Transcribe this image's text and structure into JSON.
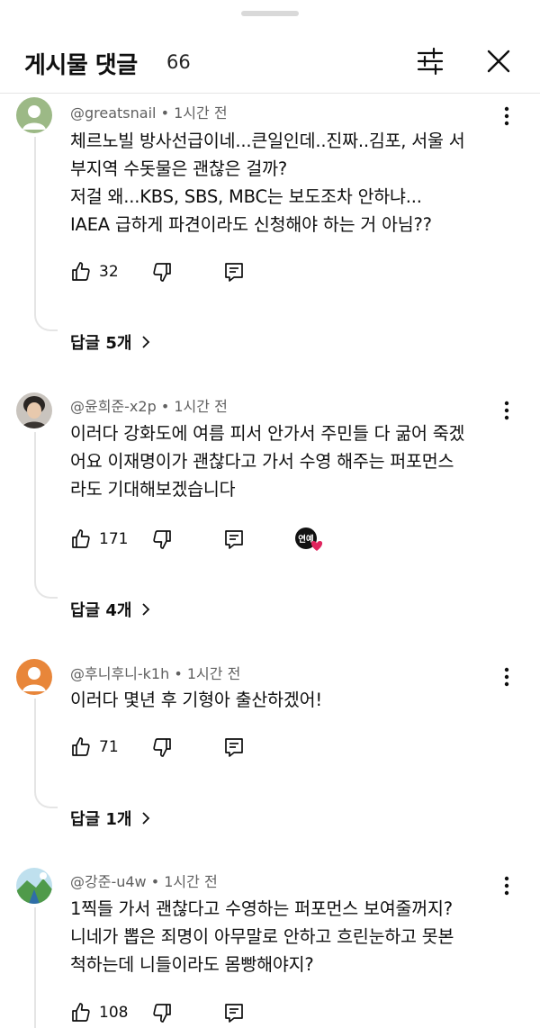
{
  "header": {
    "title": "게시물 댓글",
    "count": "66",
    "filter_icon": "sliders-icon",
    "close_icon": "close-icon"
  },
  "comments": [
    {
      "author": "@greatsnail",
      "time": "1시간 전",
      "lines": [
        "체르노빌 방사선급이네...큰일인데..진짜..김포, 서울 서",
        "부지역 수돗물은 괜찮은 걸까?",
        "저걸 왜...KBS, SBS, MBC는 보도조차 안하냐...",
        "IAEA 급하게 파견이라도 신청해야 하는 거 아님??"
      ],
      "likes": "32",
      "replies": "답글 5개"
    },
    {
      "author": "@윤희준-x2p",
      "time": "1시간 전",
      "lines": [
        "이러다 강화도에 여름 피서 안가서 주민들 다 굶어 죽겠",
        "어요 이재명이가 괜찮다고 가서 수영 해주는 퍼포먼스",
        "라도 기대해보겠습니다"
      ],
      "likes": "171",
      "creator_badge": "연예",
      "replies": "답글 4개"
    },
    {
      "author": "@후니후니-k1h",
      "time": "1시간 전",
      "lines": [
        "이러다 몇년 후 기형아 출산하겠어!"
      ],
      "likes": "71",
      "replies": "답글 1개"
    },
    {
      "author": "@강준-u4w",
      "time": "1시간 전",
      "lines": [
        "1찍들 가서 괜찮다고 수영하는 퍼포먼스 보여줄꺼지?",
        "니네가 뽑은 죄명이 아무말로 안하고 흐린눈하고 못본",
        "척하는데 니들이라도 몸빵해야지?"
      ],
      "likes": "108"
    }
  ],
  "colors": {
    "text": "#0f0f0f",
    "secondary": "#606060",
    "divider": "#e5e5e5",
    "heart": "#e0245e",
    "avatar_green": "#9cb986",
    "avatar_orange": "#e8863a"
  }
}
